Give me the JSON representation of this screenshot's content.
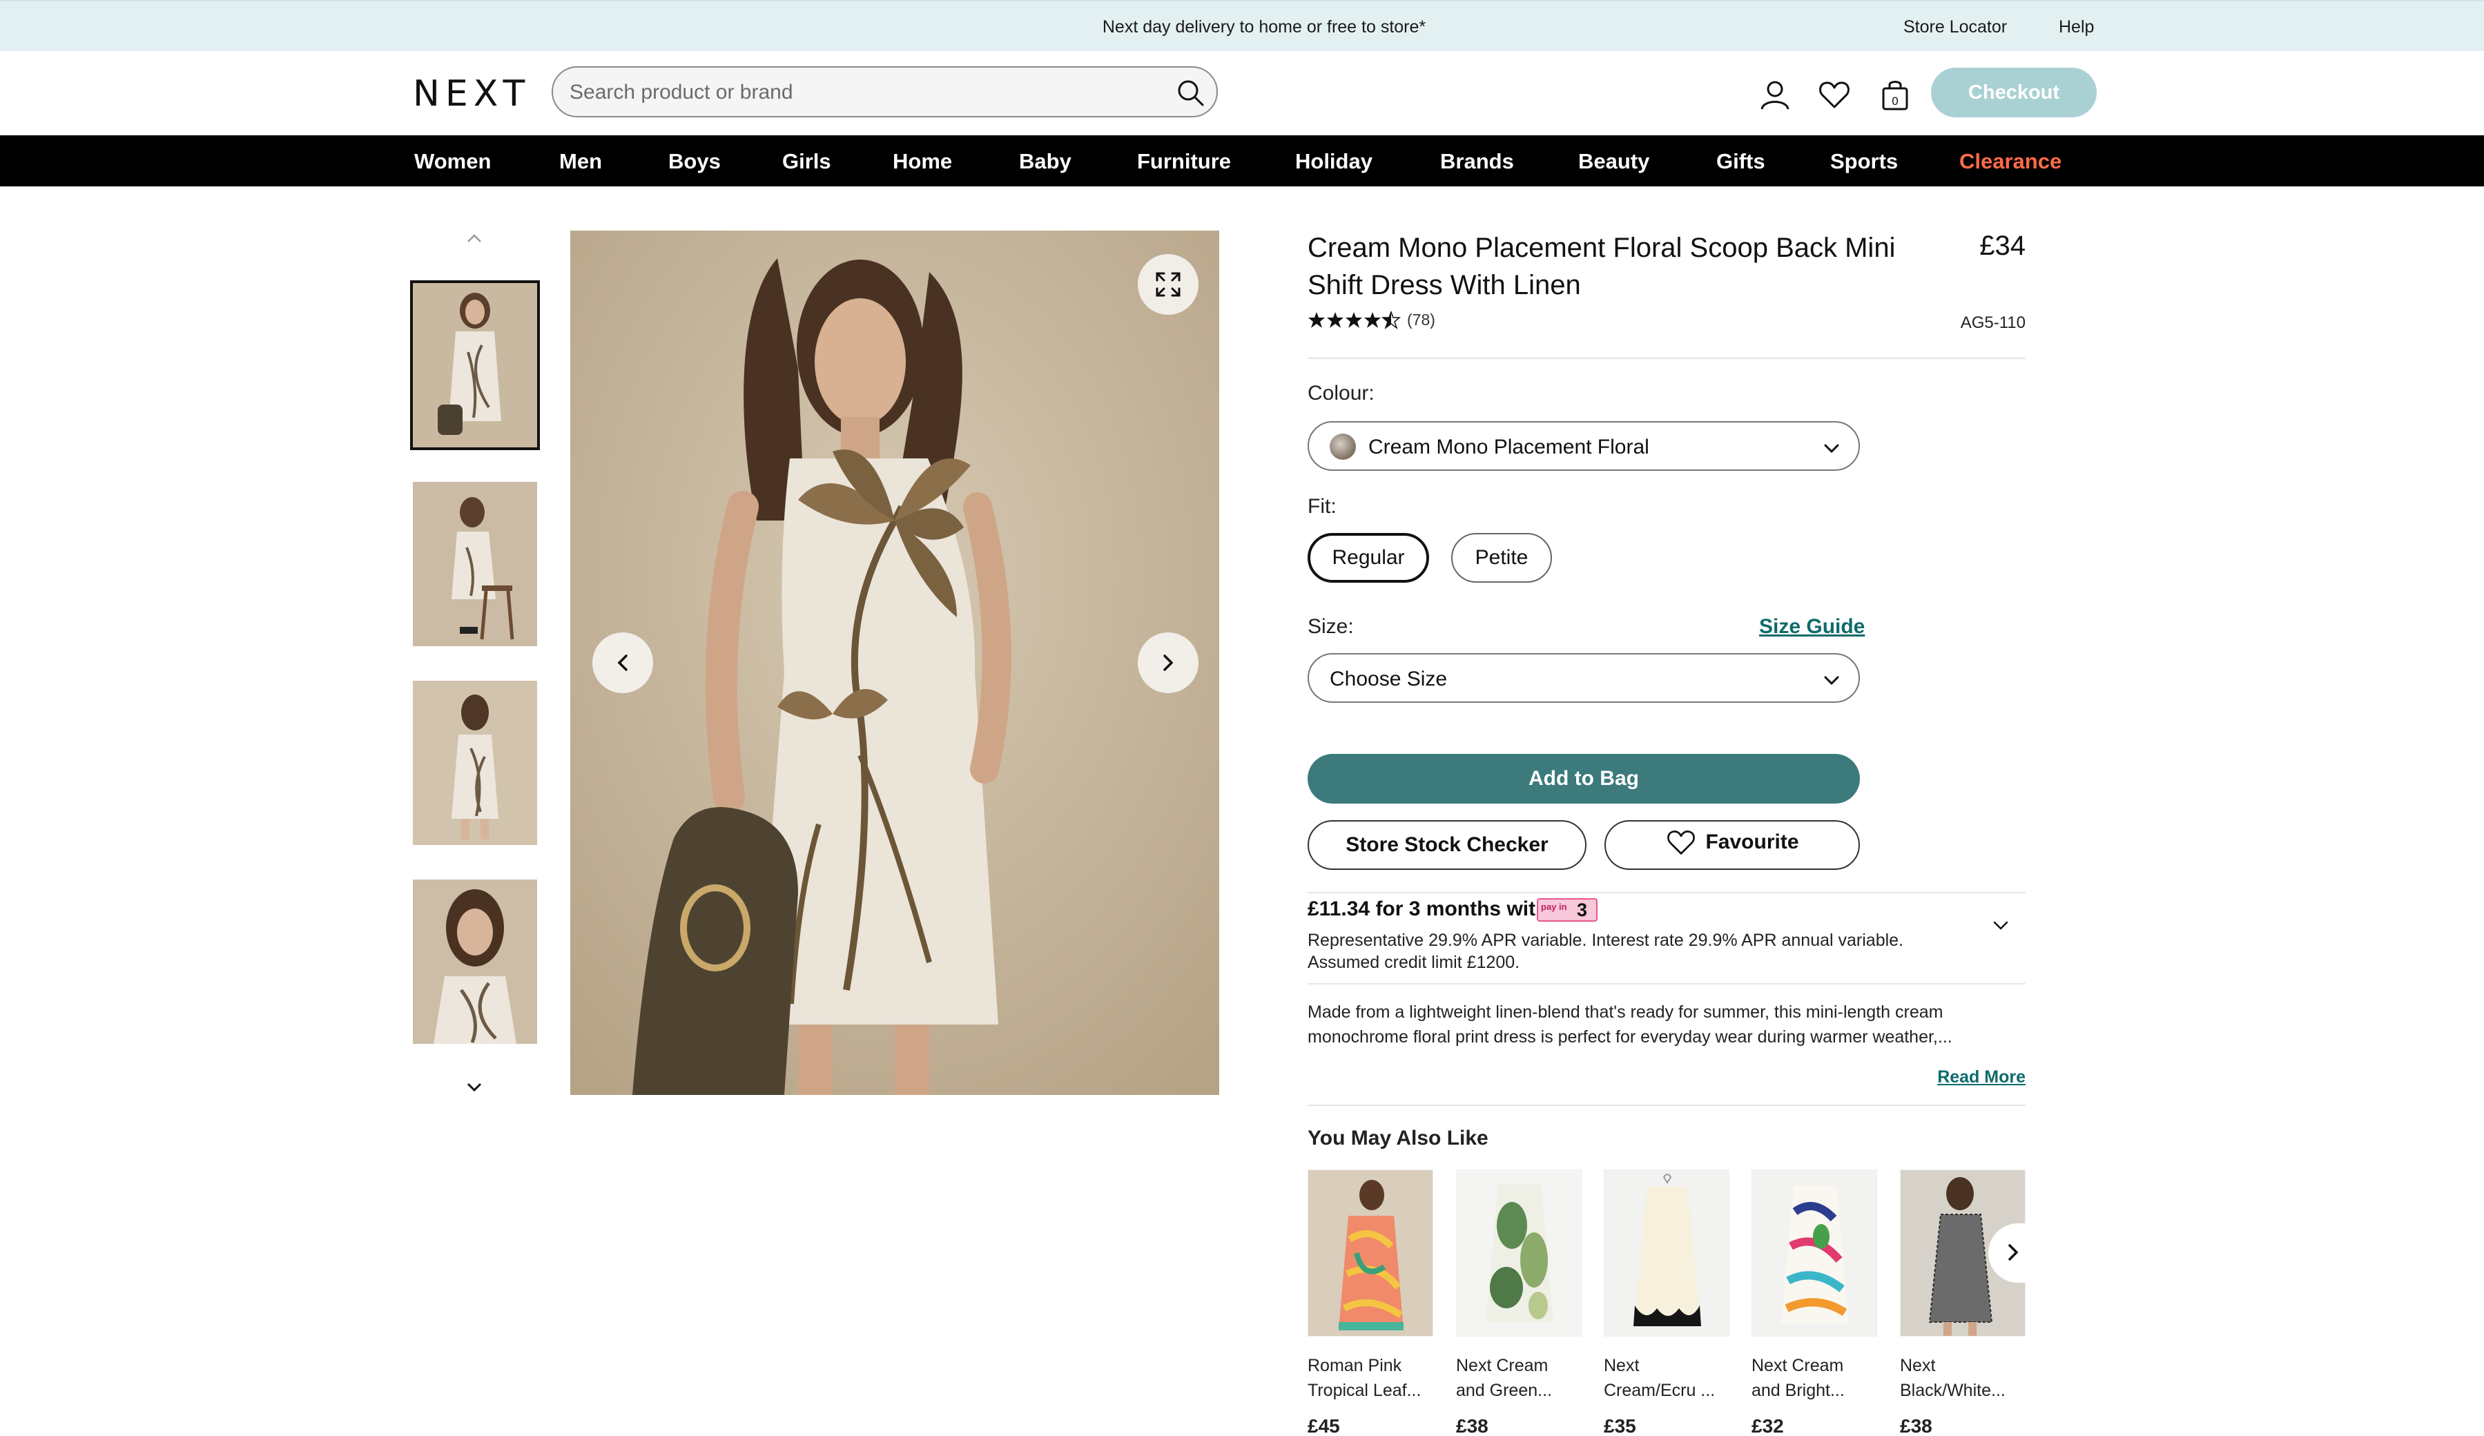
{
  "promo": {
    "message": "Next day delivery to home or free to store*",
    "store_locator": "Store Locator",
    "help": "Help"
  },
  "header": {
    "logo": "NEXT",
    "search_placeholder": "Search product or brand",
    "checkout_label": "Checkout"
  },
  "nav": {
    "items": [
      "Women",
      "Men",
      "Boys",
      "Girls",
      "Home",
      "Baby",
      "Furniture",
      "Holiday",
      "Brands",
      "Beauty",
      "Gifts",
      "Sports",
      "Clearance"
    ]
  },
  "product": {
    "title": "Cream Mono Placement Floral Scoop Back Mini Shift Dress With Linen",
    "price": "£34",
    "rating": 4.5,
    "review_count": "(78)",
    "sku": "AG5-110",
    "colour_label": "Colour:",
    "colour_value": "Cream Mono Placement Floral",
    "fit_label": "Fit:",
    "fit_options": [
      "Regular",
      "Petite"
    ],
    "fit_selected": "Regular",
    "size_label": "Size:",
    "size_guide": "Size Guide",
    "size_value": "Choose Size",
    "add_to_bag": "Add to Bag",
    "store_stock": "Store Stock Checker",
    "favourite": "Favourite",
    "finance_headline": "£11.34 for 3 months with",
    "finance_badge_small": "pay in",
    "finance_badge_num": "3",
    "finance_detail": "Representative 29.9% APR variable. Interest rate 29.9% APR annual variable. Assumed credit limit £1200.",
    "description": "Made from a lightweight linen-blend that's ready for summer, this mini-length cream monochrome floral print dress is perfect for everyday wear during warmer weather,...",
    "read_more": "Read More"
  },
  "recommendations": {
    "title": "You May Also Like",
    "items": [
      {
        "name_line1": "Roman Pink",
        "name_line2": "Tropical Leaf...",
        "price": "£45"
      },
      {
        "name_line1": "Next Cream",
        "name_line2": "and Green...",
        "price": "£38"
      },
      {
        "name_line1": "Next",
        "name_line2": "Cream/Ecru ...",
        "price": "£35"
      },
      {
        "name_line1": "Next Cream",
        "name_line2": "and Bright...",
        "price": "£32"
      },
      {
        "name_line1": "Next",
        "name_line2": "Black/White...",
        "price": "£38"
      }
    ]
  },
  "colors": {
    "accent_teal": "#3c7a7c",
    "checkout_disabled": "#a9d1d4",
    "clearance_orange": "#ff6b4a",
    "promo_bg": "#e3f0f1"
  }
}
